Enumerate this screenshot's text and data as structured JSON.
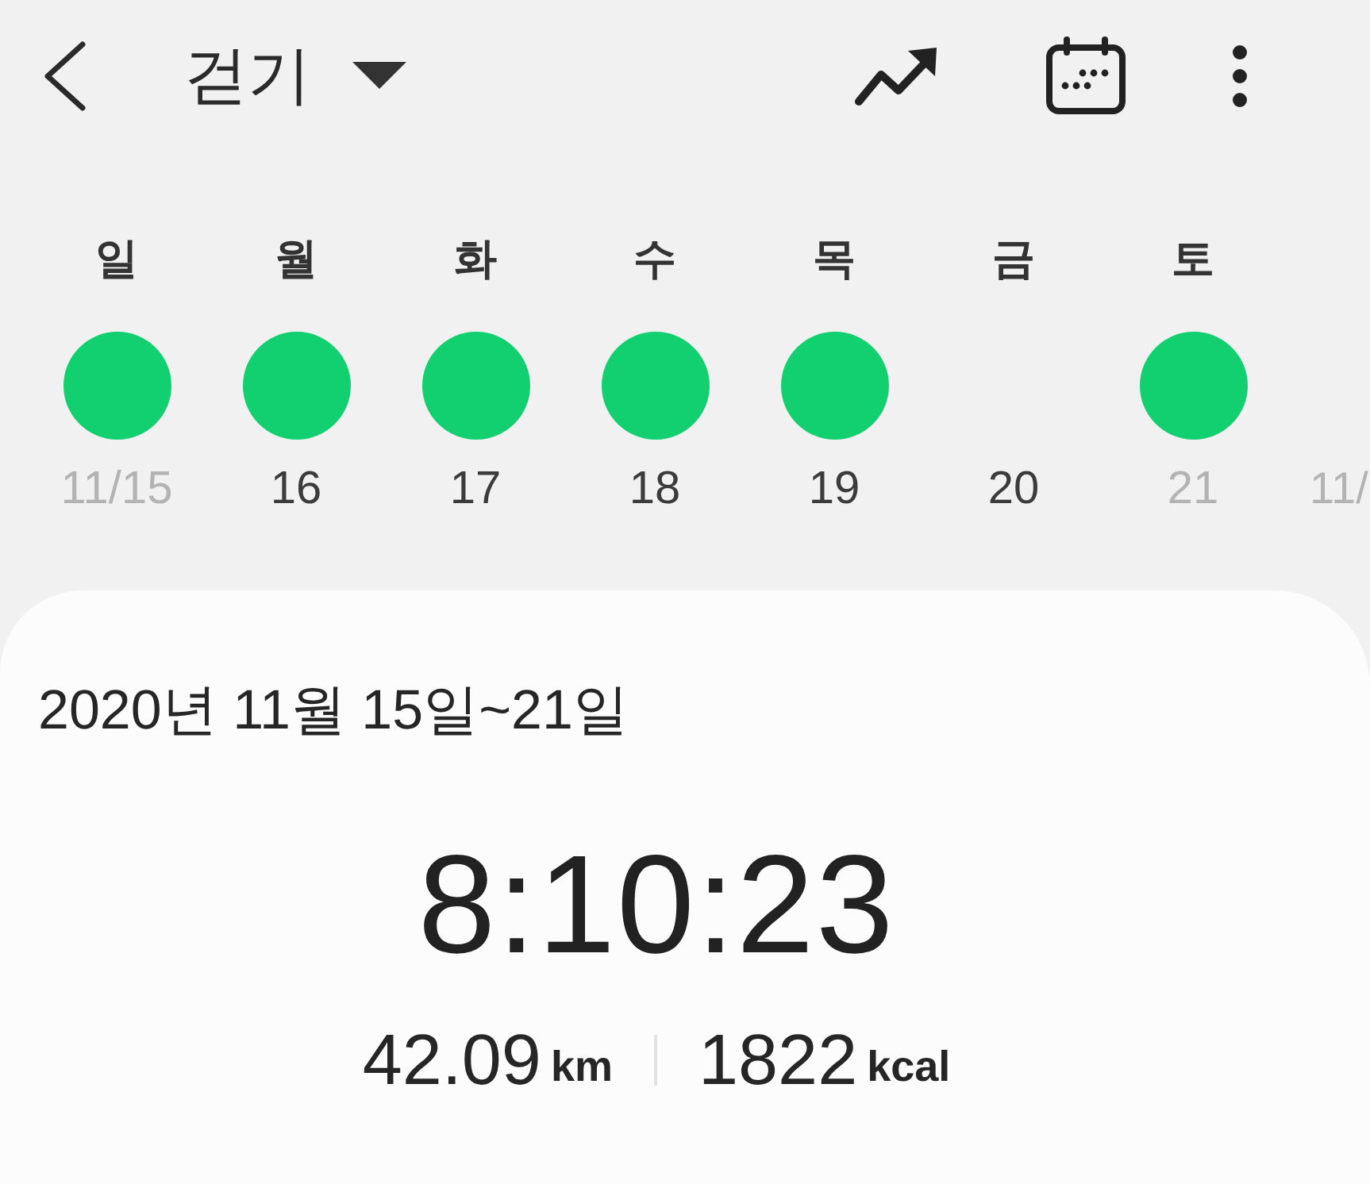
{
  "header": {
    "title": "걷기"
  },
  "week": {
    "days": [
      {
        "weekday": "일",
        "date": "11/15",
        "achieved": true,
        "dimmed": true
      },
      {
        "weekday": "월",
        "date": "16",
        "achieved": true,
        "dimmed": false
      },
      {
        "weekday": "화",
        "date": "17",
        "achieved": true,
        "dimmed": false
      },
      {
        "weekday": "수",
        "date": "18",
        "achieved": true,
        "dimmed": false
      },
      {
        "weekday": "목",
        "date": "19",
        "achieved": true,
        "dimmed": false
      },
      {
        "weekday": "금",
        "date": "20",
        "achieved": false,
        "dimmed": false
      },
      {
        "weekday": "토",
        "date": "21",
        "achieved": true,
        "dimmed": true
      }
    ],
    "overflow_date": {
      "date": "11/",
      "dimmed": true
    }
  },
  "summary": {
    "range": "2020년 11월 15일~21일",
    "duration": "8:10:23",
    "distance": {
      "value": "42.09",
      "unit": "km"
    },
    "calories": {
      "value": "1822",
      "unit": "kcal"
    }
  }
}
